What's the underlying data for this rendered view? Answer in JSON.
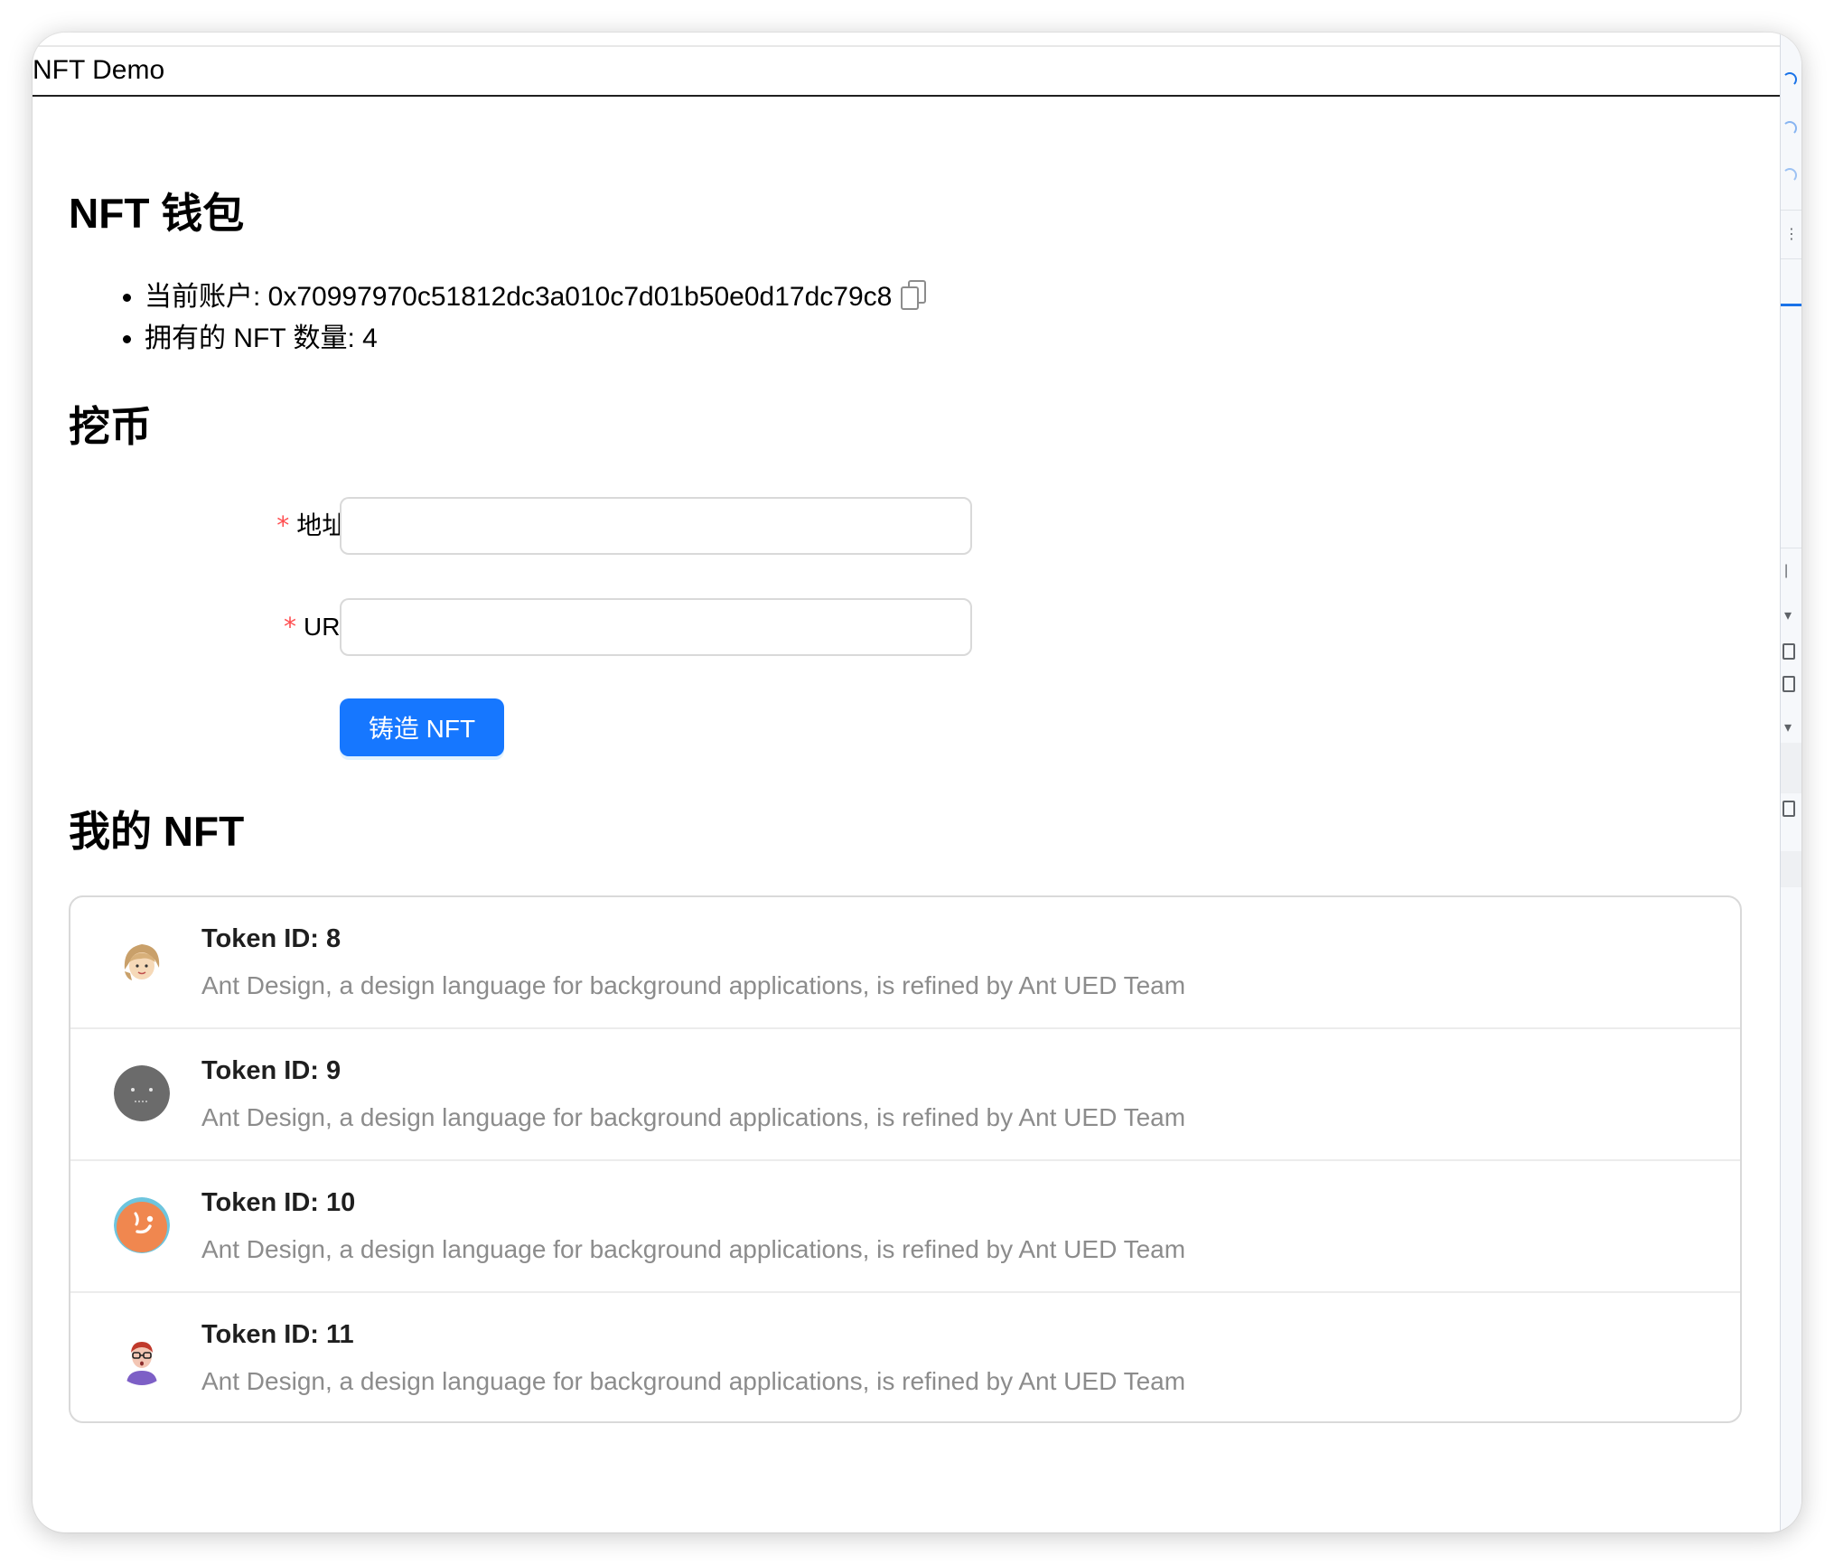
{
  "header": {
    "title": "NFT Demo"
  },
  "wallet": {
    "heading": "NFT 钱包",
    "account_label": "当前账户: ",
    "account_address": "0x70997970c51812dc3a010c7d01b50e0d17dc79c8",
    "balance_label": "拥有的 NFT 数量: ",
    "balance_value": "4"
  },
  "mint": {
    "heading": "挖币",
    "address_label": "地址",
    "address_value": "",
    "uri_label": "URI",
    "uri_value": "",
    "required_mark": "*",
    "colon": ":",
    "submit_label": "铸造 NFT"
  },
  "my_nfts": {
    "heading": "我的 NFT",
    "items": [
      {
        "title": "Token ID: 8",
        "description": "Ant Design, a design language for background applications, is refined by Ant UED Team",
        "avatar_icon": "avatar-girl-icon"
      },
      {
        "title": "Token ID: 9",
        "description": "Ant Design, a design language for background applications, is refined by Ant UED Team",
        "avatar_icon": "avatar-gray-face-icon"
      },
      {
        "title": "Token ID: 10",
        "description": "Ant Design, a design language for background applications, is refined by Ant UED Team",
        "avatar_icon": "avatar-orange-face-icon"
      },
      {
        "title": "Token ID: 11",
        "description": "Ant Design, a design language for background applications, is refined by Ant UED Team",
        "avatar_icon": "avatar-glasses-person-icon"
      }
    ]
  },
  "colors": {
    "primary": "#1677ff",
    "required": "#ff4d4f",
    "description_text": "#8c8c8c",
    "border": "#d9d9d9"
  }
}
